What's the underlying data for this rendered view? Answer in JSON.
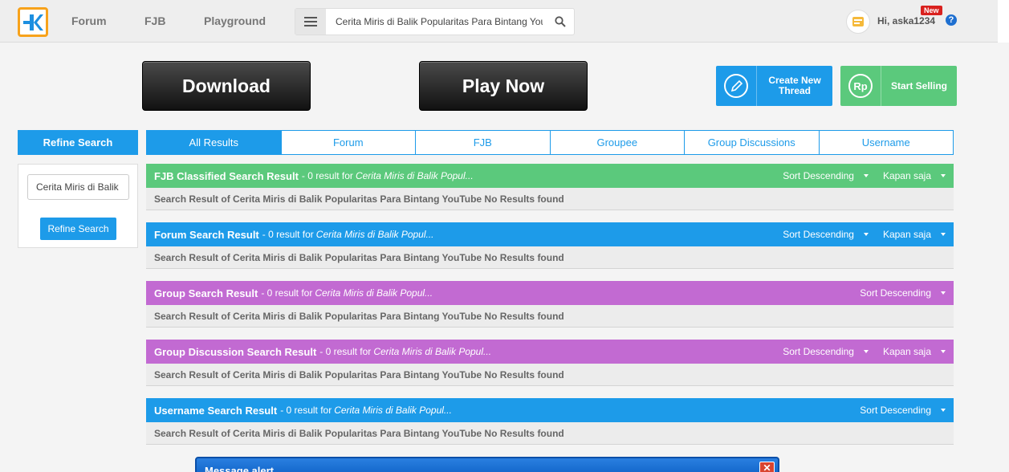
{
  "header": {
    "nav": [
      {
        "label": "Forum"
      },
      {
        "label": "FJB"
      },
      {
        "label": "Playground"
      }
    ],
    "search_value": "Cerita Miris di Balik Popularitas Para Bintang YouTube",
    "greeting": "Hi, aska1234",
    "new_badge": "New",
    "help": "?"
  },
  "promo": {
    "download": "Download",
    "play_now": "Play Now"
  },
  "actions": {
    "create_thread": "Create New Thread",
    "start_selling": "Start Selling"
  },
  "refine": {
    "title": "Refine Search",
    "input_value": "Cerita Miris di Balik Popularitas Para Bintang YouTube",
    "button": "Refine Search"
  },
  "tabs": [
    {
      "label": "All Results"
    },
    {
      "label": "Forum"
    },
    {
      "label": "FJB"
    },
    {
      "label": "Groupee"
    },
    {
      "label": "Group Discussions"
    },
    {
      "label": "Username"
    }
  ],
  "sections": [
    {
      "title": "FJB Classified Search Result",
      "meta": "- 0 result for",
      "query": "Cerita Miris di Balik Popul...",
      "sort": "Sort Descending",
      "time": "Kapan saja",
      "body": "Search Result of Cerita Miris di Balik Popularitas Para Bintang YouTube No Results found"
    },
    {
      "title": "Forum Search Result",
      "meta": "- 0 result for",
      "query": "Cerita Miris di Balik Popul...",
      "sort": "Sort Descending",
      "time": "Kapan saja",
      "body": "Search Result of Cerita Miris di Balik Popularitas Para Bintang YouTube No Results found"
    },
    {
      "title": "Group Search Result",
      "meta": "- 0 result for",
      "query": "Cerita Miris di Balik Popul...",
      "sort": "Sort Descending",
      "body": "Search Result of Cerita Miris di Balik Popularitas Para Bintang YouTube No Results found"
    },
    {
      "title": "Group Discussion Search Result",
      "meta": "- 0 result for",
      "query": "Cerita Miris di Balik Popul...",
      "sort": "Sort Descending",
      "time": "Kapan saja",
      "body": "Search Result of Cerita Miris di Balik Popularitas Para Bintang YouTube No Results found"
    },
    {
      "title": "Username Search Result",
      "meta": "- 0 result for",
      "query": "Cerita Miris di Balik Popul...",
      "sort": "Sort Descending",
      "body": "Search Result of Cerita Miris di Balik Popularitas Para Bintang YouTube No Results found"
    }
  ],
  "alert": {
    "title": "Message alert"
  },
  "colors": {
    "primary": "#1d9be9",
    "fjb": "#5bc97c",
    "group": "#c26ad2",
    "logo_accent": "#f7a21b",
    "badge": "#d9211e"
  }
}
